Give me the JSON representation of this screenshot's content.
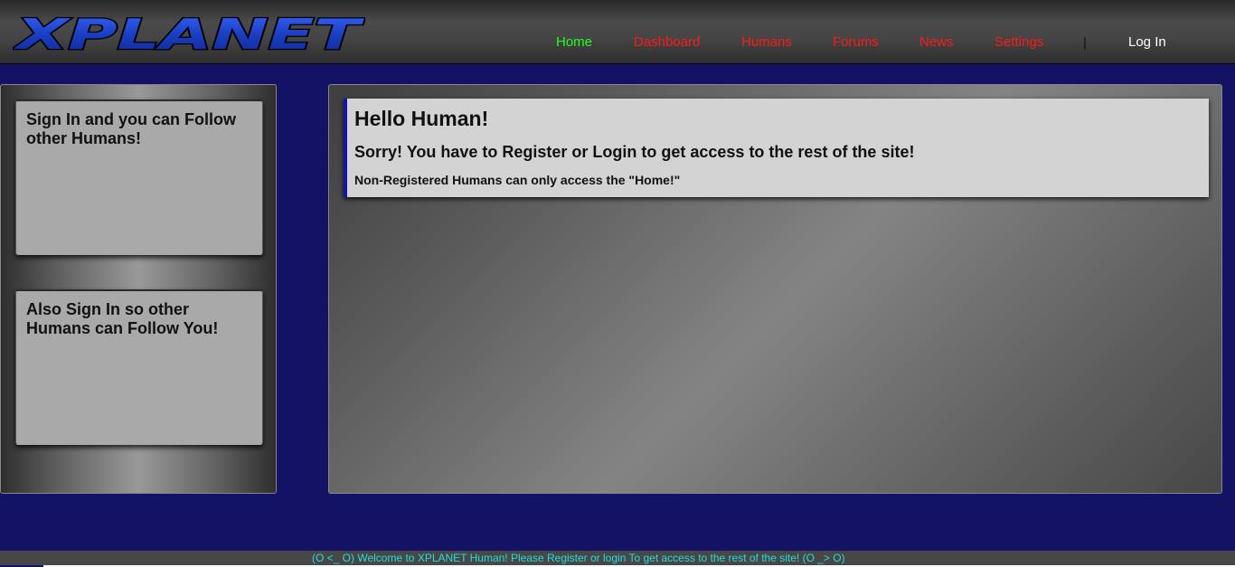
{
  "brand": {
    "logo_text": "XPLANET"
  },
  "nav": {
    "items": [
      {
        "label": "Home",
        "state": "active"
      },
      {
        "label": "Dashboard"
      },
      {
        "label": "Humans"
      },
      {
        "label": "Forums"
      },
      {
        "label": "News"
      },
      {
        "label": "Settings"
      }
    ],
    "separator": "|",
    "login_label": "Log In"
  },
  "sidebar": {
    "cards": [
      {
        "text": "Sign In and you can Follow other Humans!"
      },
      {
        "text": "Also Sign In so other Humans can Follow You!"
      }
    ]
  },
  "main": {
    "notice": {
      "title": "Hello Human!",
      "subtitle": "Sorry! You have to Register or Login to get access to the rest of the site!",
      "note": "Non-Registered Humans can only access the \"Home!\""
    }
  },
  "ticker": {
    "text": "(O <_ O) Welcome to XPLANET Human! Please Register or login To get access to the rest of the site! (O _> O)"
  },
  "colors": {
    "page_background": "#131265",
    "nav_link": "#ff1a1a",
    "nav_active": "#22ff22",
    "login_link": "#ffffff",
    "notice_accent": "#1414a8",
    "ticker_text": "#22dede",
    "logo_fill": "#1a3fc4"
  }
}
